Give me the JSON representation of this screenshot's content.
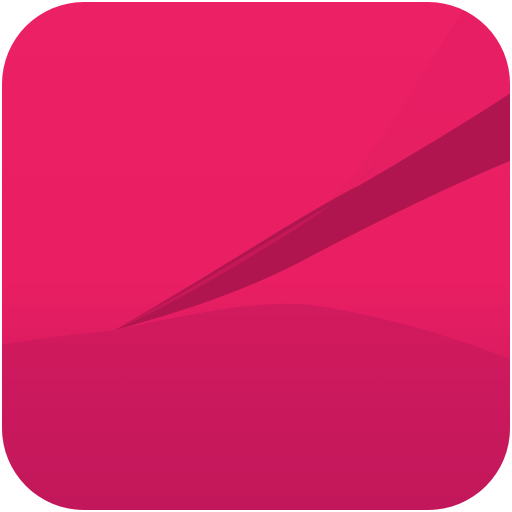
{
  "icon": {
    "name": "wallpaper-app-icon",
    "colors": {
      "base": "#E91E63",
      "base_light": "#EC2064",
      "base_dark": "#C2185B",
      "fold_shadow": "#B0154F",
      "fold_mid": "#D51A5B",
      "fold_light": "#E01C60"
    }
  }
}
